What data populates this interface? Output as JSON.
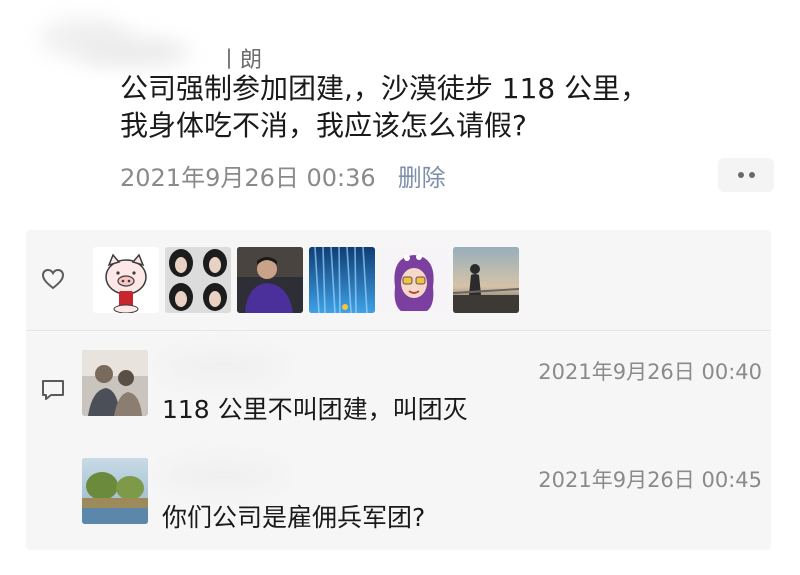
{
  "post": {
    "author_name_fragment": "丨朗",
    "text_line1": "公司强制参加团建,，沙漠徒步 118 公里，",
    "text_line2": "我身体吃不消，我应该怎么请假?",
    "timestamp": "2021年9月26日 00:36",
    "delete_label": "删除"
  },
  "likes": {
    "icon": "heart-icon",
    "avatars": [
      {
        "name": "avatar-pig-cartoon"
      },
      {
        "name": "avatar-girl-photo-grid"
      },
      {
        "name": "avatar-man-purple-shirt"
      },
      {
        "name": "avatar-blue-waterfall"
      },
      {
        "name": "avatar-cartoon-girl-purple-hair"
      },
      {
        "name": "avatar-sunset-silhouette"
      }
    ]
  },
  "comments": [
    {
      "timestamp": "2021年9月26日 00:40",
      "text": "118 公里不叫团建，叫团灭"
    },
    {
      "timestamp": "2021年9月26日 00:45",
      "text": "你们公司是雇佣兵军团?"
    }
  ],
  "colors": {
    "panel_bg": "#f6f6f6",
    "link": "#7d8fa9",
    "meta_text": "#8a8a8a"
  }
}
